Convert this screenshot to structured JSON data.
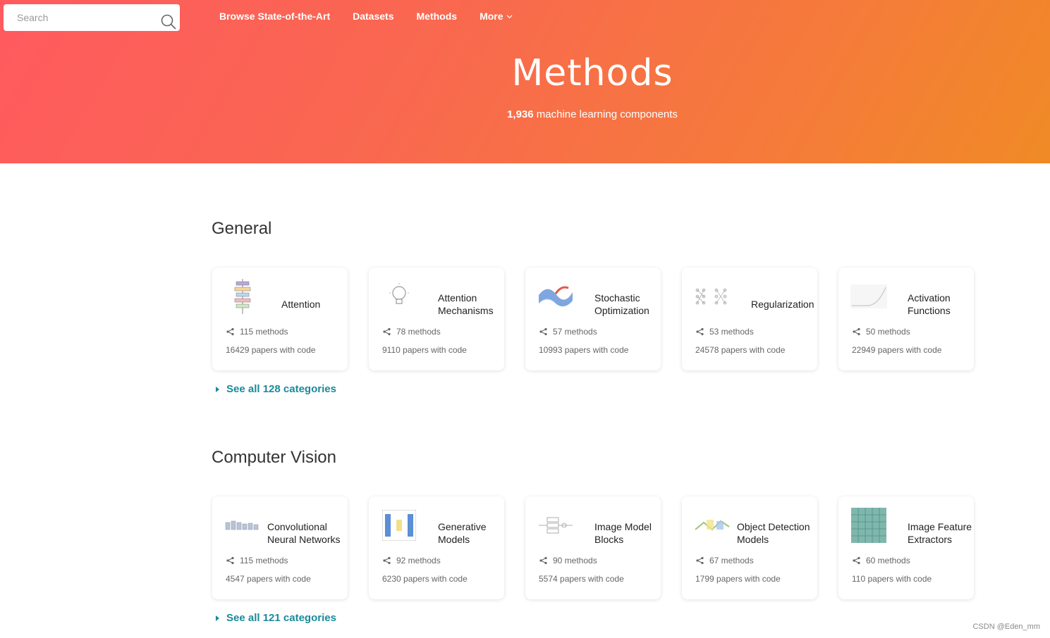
{
  "search": {
    "placeholder": "Search"
  },
  "nav": {
    "items": [
      "Browse State-of-the-Art",
      "Datasets",
      "Methods"
    ],
    "more": "More"
  },
  "hero": {
    "title": "Methods",
    "count": "1,936",
    "subtitle": "machine learning components"
  },
  "sections": [
    {
      "title": "General",
      "see_all": "See all 128 categories",
      "cards": [
        {
          "title": "Attention",
          "methods": "115 methods",
          "papers": "16429 papers with code",
          "icon": "attention-diagram-icon"
        },
        {
          "title": "Attention Mechanisms",
          "methods": "78 methods",
          "papers": "9110 papers with code",
          "icon": "lightbulb-icon"
        },
        {
          "title": "Stochastic Optimization",
          "methods": "57 methods",
          "papers": "10993 papers with code",
          "icon": "loss-surface-icon"
        },
        {
          "title": "Regularization",
          "methods": "53 methods",
          "papers": "24578 papers with code",
          "icon": "dropout-network-icon"
        },
        {
          "title": "Activation Functions",
          "methods": "50 methods",
          "papers": "22949 papers with code",
          "icon": "activation-curve-icon"
        }
      ]
    },
    {
      "title": "Computer Vision",
      "see_all": "See all 121 categories",
      "cards": [
        {
          "title": "Convolutional Neural Networks",
          "methods": "115 methods",
          "papers": "4547 papers with code",
          "icon": "cnn-diagram-icon"
        },
        {
          "title": "Generative Models",
          "methods": "92 methods",
          "papers": "6230 papers with code",
          "icon": "generative-diagram-icon"
        },
        {
          "title": "Image Model Blocks",
          "methods": "90 methods",
          "papers": "5574 papers with code",
          "icon": "block-diagram-icon"
        },
        {
          "title": "Object Detection Models",
          "methods": "67 methods",
          "papers": "1799 papers with code",
          "icon": "detection-diagram-icon"
        },
        {
          "title": "Image Feature Extractors",
          "methods": "60 methods",
          "papers": "110 papers with code",
          "icon": "feature-grid-icon"
        }
      ]
    }
  ],
  "watermark": "CSDN @Eden_mm",
  "colors": {
    "hero_start": "#ff5a5f",
    "hero_end": "#f08a26",
    "link": "#1a8a9a"
  }
}
